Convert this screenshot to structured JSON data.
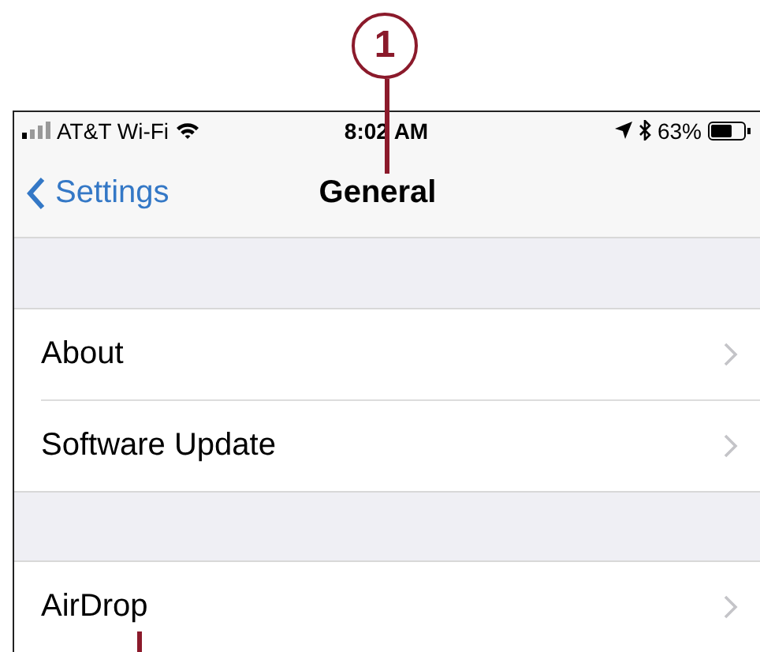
{
  "callouts": [
    {
      "label": "1"
    }
  ],
  "status_bar": {
    "carrier": "AT&T Wi-Fi",
    "time": "8:02 AM",
    "battery": "63%"
  },
  "nav_bar": {
    "back": "Settings",
    "title": "General"
  },
  "sections": [
    {
      "rows": [
        {
          "label": "About"
        },
        {
          "label": "Software Update"
        }
      ]
    },
    {
      "rows": [
        {
          "label": "AirDrop"
        }
      ]
    }
  ]
}
